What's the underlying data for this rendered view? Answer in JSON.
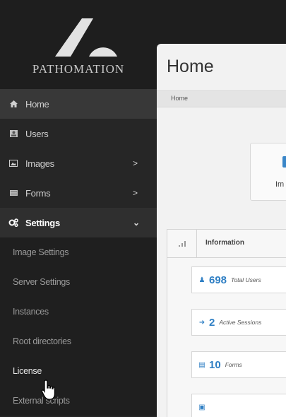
{
  "brand": {
    "name": "PATHOMATION"
  },
  "sidebar": {
    "items": [
      {
        "icon": "home-icon",
        "label": "Home"
      },
      {
        "icon": "user-icon",
        "label": "Users"
      },
      {
        "icon": "image-icon",
        "label": "Images",
        "chevron": ">"
      },
      {
        "icon": "form-icon",
        "label": "Forms",
        "chevron": ">"
      },
      {
        "icon": "cogs-icon",
        "label": "Settings",
        "chevron": "⌄",
        "active": true
      }
    ],
    "settings_sub": [
      "Image Settings",
      "Server Settings",
      "Instances",
      "Root directories",
      "License",
      "External scripts"
    ]
  },
  "main": {
    "title": "Home",
    "breadcrumb": "Home",
    "tile_label": "Im",
    "info_panel": {
      "title": "Information",
      "stats": [
        {
          "icon": "user-icon",
          "value": "698",
          "label": "Total Users"
        },
        {
          "icon": "arrow-right-icon",
          "value": "2",
          "label": "Active Sessions"
        },
        {
          "icon": "form-icon",
          "value": "10",
          "label": "Forms"
        },
        {
          "icon": "image-icon",
          "value": "",
          "label": ""
        }
      ]
    }
  },
  "colors": {
    "accent": "#2f7fc4",
    "sidebar": "#262626",
    "panel": "#f2f2f2"
  }
}
